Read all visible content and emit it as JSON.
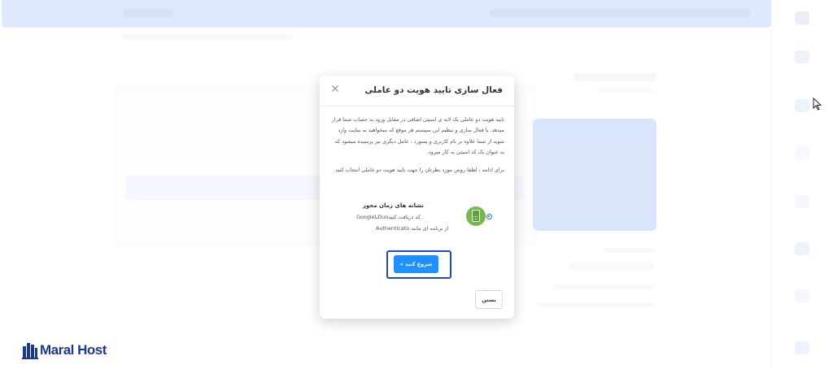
{
  "modal": {
    "title": "فعال سازی تایید هویت دو عاملی",
    "close_icon": "close-icon",
    "description": "تایید هویت دو عاملی یک لایه ی امنیتی اضافی در مقابل ورود به حساب شما قرار میدهد. با فعال سازی و تنظیم این سیستم هر موقع که میخواهید به سایت وارد شوید از شما علاوه بر نام کاربری و پسورد ، عامل دیگری نیز پرسیده میشود که به عنوان یک کد امنیتی به کار میرود.",
    "instruction": "برای ادامه ، لطفا روش مورد نظرتان را جهت تایید هویت دو عاملی انتخاب کنید",
    "option": {
      "title": "نشانه های زمان محور",
      "line1": ". کد دریافت کنیدDuoیاGoogle",
      "line2": "Authenticato از برنامه ای مانند",
      "icon": "phone-authenticator-icon",
      "selected": true
    },
    "start_button": "شروع کنید »",
    "close_button": "بستن"
  },
  "logo": {
    "text": "Maral Host"
  },
  "colors": {
    "primary": "#1e90ff",
    "highlight": "#2446c7",
    "option_icon": "#76b84d",
    "logo": "#1b3a8c"
  }
}
